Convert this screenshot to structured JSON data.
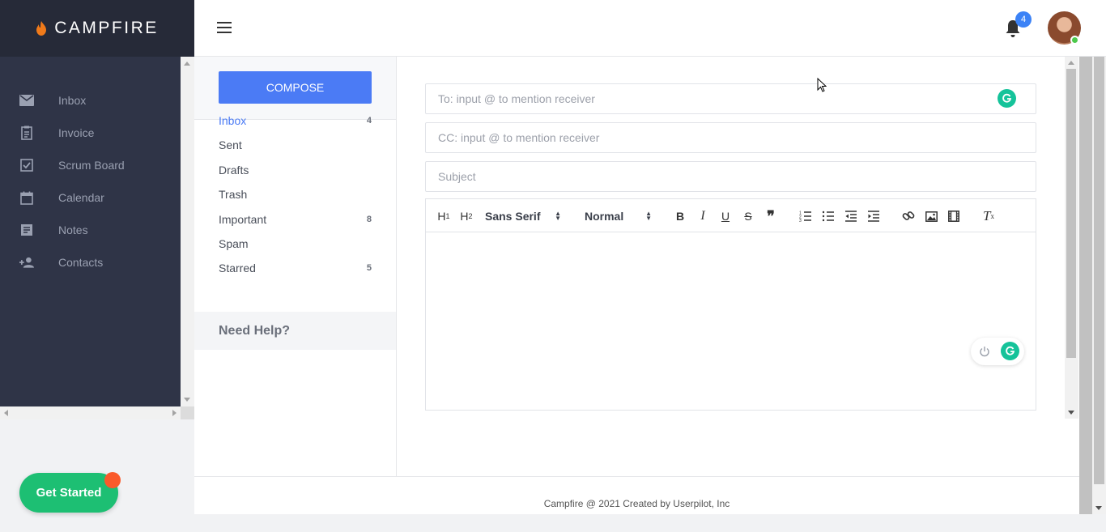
{
  "brand": {
    "name": "CAMPFIRE"
  },
  "sidebar": {
    "items": [
      {
        "label": "Inbox",
        "icon": "mail-icon"
      },
      {
        "label": "Invoice",
        "icon": "clipboard-icon"
      },
      {
        "label": "Scrum Board",
        "icon": "checkbox-icon"
      },
      {
        "label": "Calendar",
        "icon": "calendar-icon"
      },
      {
        "label": "Notes",
        "icon": "notes-icon"
      },
      {
        "label": "Contacts",
        "icon": "add-person-icon"
      }
    ]
  },
  "header": {
    "notification_count": "4"
  },
  "mailbox": {
    "compose_label": "COMPOSE",
    "folders": [
      {
        "name": "Inbox",
        "count": "4"
      },
      {
        "name": "Sent",
        "count": ""
      },
      {
        "name": "Drafts",
        "count": ""
      },
      {
        "name": "Trash",
        "count": ""
      },
      {
        "name": "Important",
        "count": "8"
      },
      {
        "name": "Spam",
        "count": ""
      },
      {
        "name": "Starred",
        "count": "5"
      }
    ],
    "help_label": "Need Help?"
  },
  "compose_form": {
    "to_placeholder": "To: input @ to mention receiver",
    "cc_placeholder": "CC: input @ to mention receiver",
    "subject_placeholder": "Subject",
    "font_select": "Sans Serif",
    "size_select": "Normal",
    "toolbar_text": {
      "h1": "H",
      "h2": "H",
      "bold": "B",
      "italic": "I",
      "underline": "U",
      "strike": "S",
      "quote": "❞",
      "clear": "T"
    }
  },
  "footer": {
    "text": "Campfire @ 2021 Created by Userpilot, Inc"
  },
  "get_started": {
    "label": "Get Started"
  },
  "colors": {
    "accent": "#4b7bf5",
    "sidebar": "#2f3447",
    "get_started": "#1dbf73",
    "grammarly": "#15c39a"
  }
}
